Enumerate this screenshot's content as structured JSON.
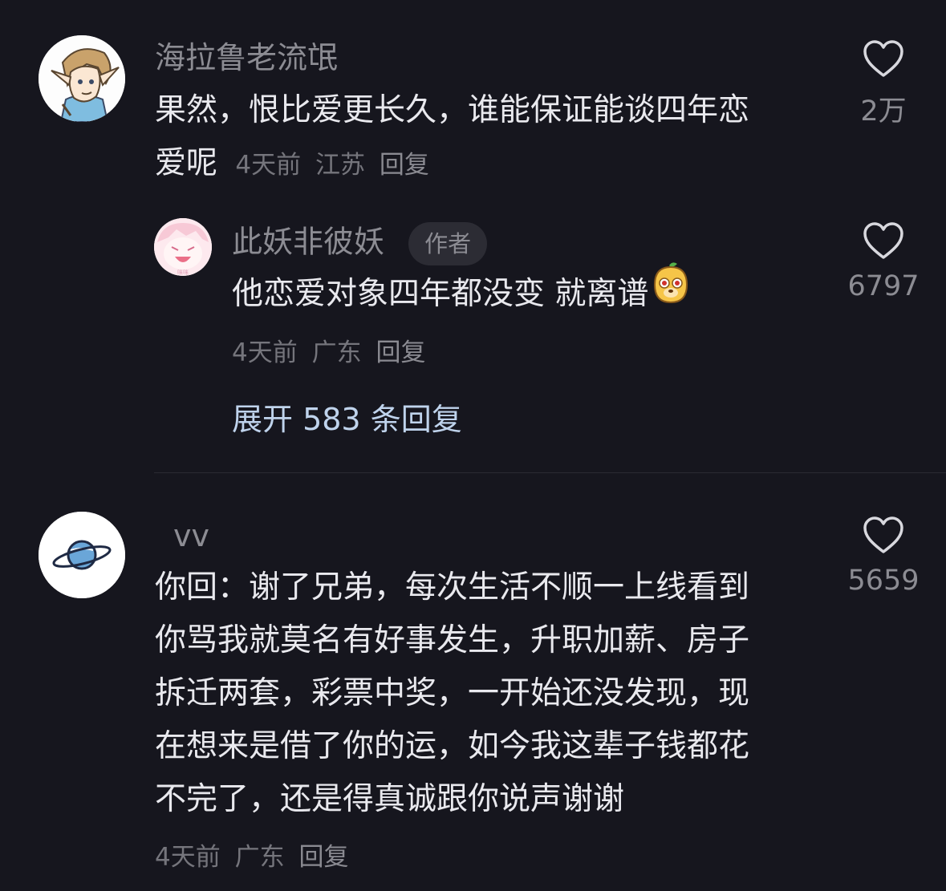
{
  "comments": [
    {
      "username": "海拉鲁老流氓",
      "text_line1": "果然，恨比爱更长久，谁能保证能谈四年恋",
      "text_line2": "爱呢",
      "time": "4天前",
      "location": "江苏",
      "reply_label": "回复",
      "likes": "2万",
      "avatar_icon": "elf-character-avatar"
    },
    {
      "username": "此妖非彼妖",
      "badge": "作者",
      "text": "他恋爱对象四年都没变 就离谱",
      "emoji_icon": "dog-face-emoji",
      "time": "4天前",
      "location": "广东",
      "reply_label": "回复",
      "likes": "6797",
      "avatar_icon": "anime-girl-avatar",
      "expand_label": "展开 583 条回复"
    },
    {
      "username": "vv",
      "lines": [
        "你回：谢了兄弟，每次生活不顺一上线看到",
        "你骂我就莫名有好事发生，升职加薪、房子",
        "拆迁两套，彩票中奖，一开始还没发现，现",
        "在想来是借了你的运，如今我这辈子钱都花",
        "不完了，还是得真诚跟你说声谢谢"
      ],
      "time": "4天前",
      "location": "广东",
      "reply_label": "回复",
      "likes": "5659",
      "avatar_icon": "planet-avatar"
    }
  ],
  "colors": {
    "background": "#16161e",
    "text": "#e9e9ee",
    "muted": "#8c8c93",
    "link": "#bfd3ec"
  }
}
